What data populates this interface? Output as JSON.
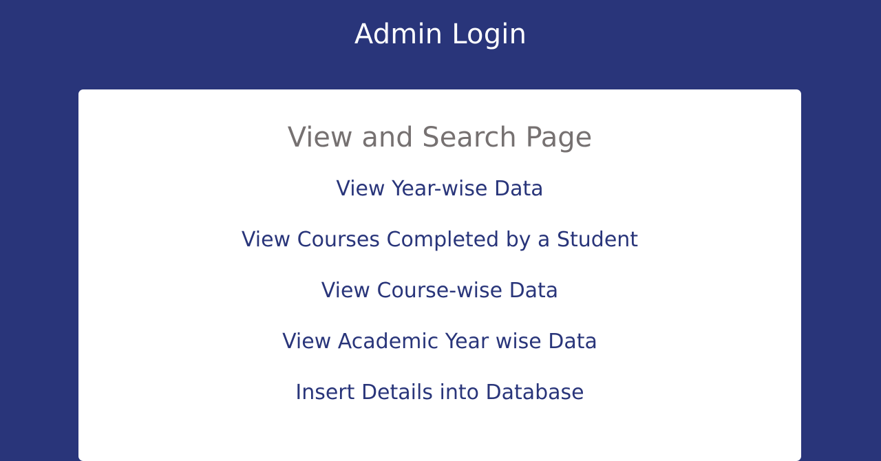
{
  "header": {
    "title": "Admin Login"
  },
  "card": {
    "title": "View and Search Page",
    "links": [
      "View Year-wise Data",
      "View Courses Completed by a Student",
      "View Course-wise Data",
      "View Academic Year wise Data",
      "Insert Details into Database"
    ]
  },
  "colors": {
    "background": "#29357a",
    "card": "#ffffff",
    "card_title": "#767171",
    "link": "#29357a"
  }
}
